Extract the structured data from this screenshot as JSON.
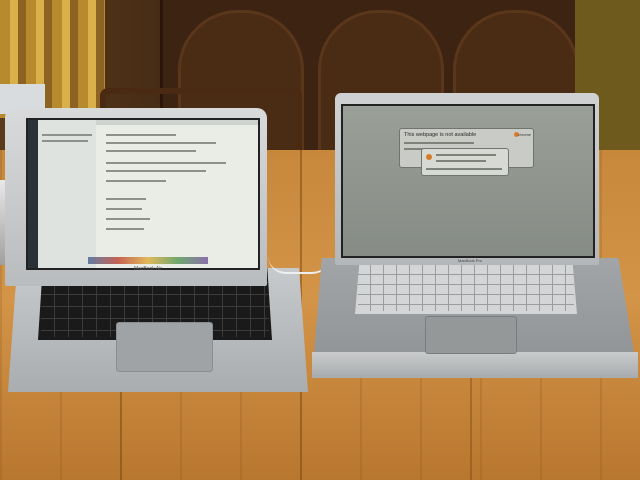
{
  "scene": {
    "description_id": "two-laptops-on-wooden-table"
  },
  "laptop_left": {
    "brand_label": "MacBook Air"
  },
  "laptop_right": {
    "brand_label": "MacBook Pro",
    "dialog_title": "This webpage is not available",
    "dialog_brand": "chrome"
  }
}
